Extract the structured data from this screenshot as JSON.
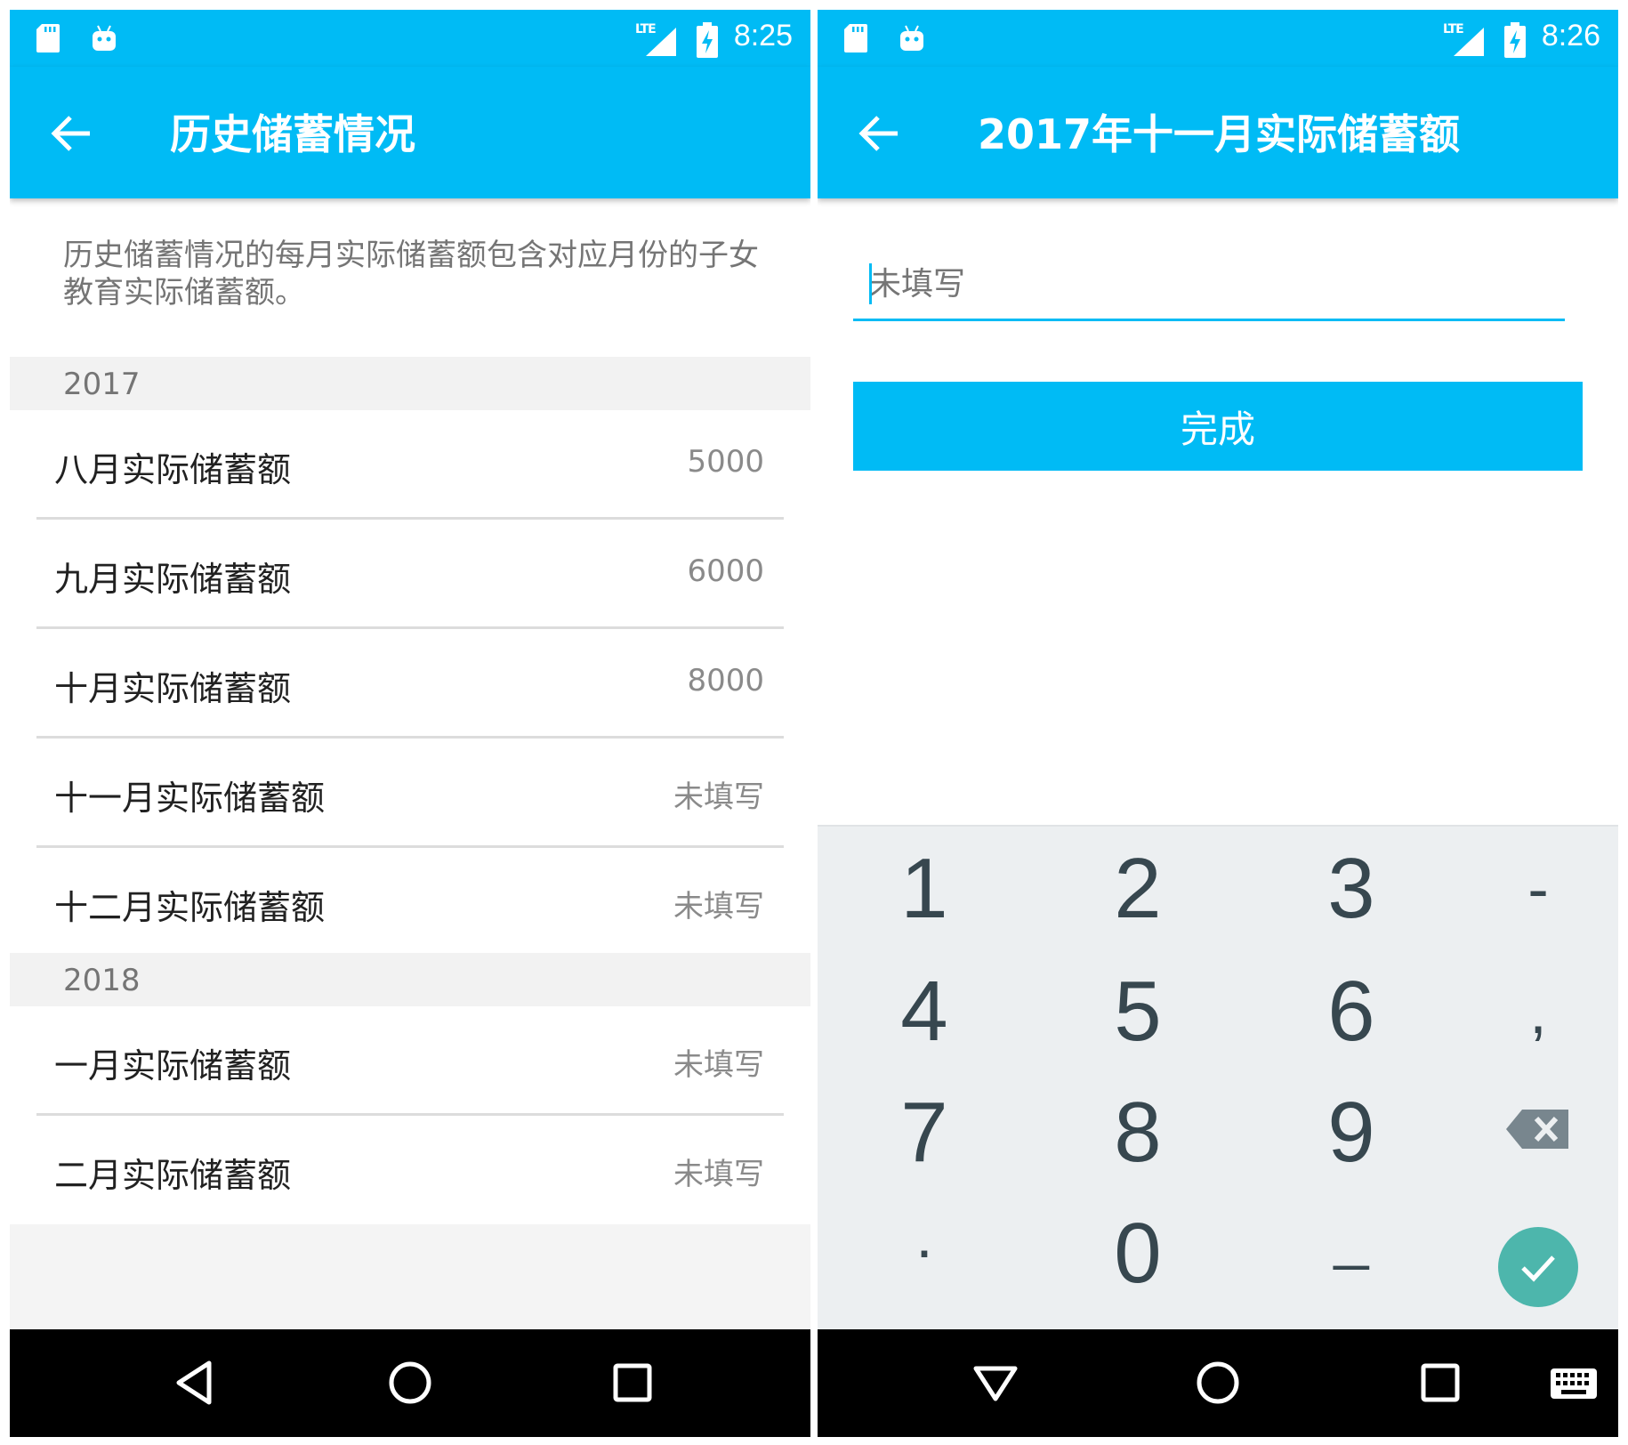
{
  "left": {
    "status_time": "8:25",
    "lte_label": "LTE",
    "title": "历史储蓄情况",
    "intro_text": "历史储蓄情况的每月实际储蓄额包含对应月份的子女教育实际储蓄额。",
    "sections": [
      {
        "year": "2017",
        "items": [
          {
            "label": "八月实际储蓄额",
            "value": "5000"
          },
          {
            "label": "九月实际储蓄额",
            "value": "6000"
          },
          {
            "label": "十月实际储蓄额",
            "value": "8000"
          },
          {
            "label": "十一月实际储蓄额",
            "value": "未填写"
          },
          {
            "label": "十二月实际储蓄额",
            "value": "未填写"
          }
        ]
      },
      {
        "year": "2018",
        "items": [
          {
            "label": "一月实际储蓄额",
            "value": "未填写"
          },
          {
            "label": "二月实际储蓄额",
            "value": "未填写"
          }
        ]
      }
    ]
  },
  "right": {
    "status_time": "8:26",
    "lte_label": "LTE",
    "title": "2017年十一月实际储蓄额",
    "input_placeholder": "未填写",
    "done_label": "完成",
    "keys": {
      "k1": "1",
      "k2": "2",
      "k3": "3",
      "minus": "-",
      "k4": "4",
      "k5": "5",
      "k6": "6",
      "comma": ",",
      "k7": "7",
      "k8": "8",
      "k9": "9",
      "dot": ".",
      "k0": "0",
      "underscore": "_"
    }
  },
  "colors": {
    "primary": "#00bbf5",
    "keypad_bg": "#eceff1",
    "enter_key": "#4db6ac"
  },
  "icons": {
    "back": "arrow-left-icon",
    "nav_back": "triangle-back-icon",
    "nav_home": "circle-home-icon",
    "nav_recents": "square-recents-icon",
    "backspace": "backspace-icon",
    "enter": "check-icon",
    "keyboard": "keyboard-icon"
  }
}
